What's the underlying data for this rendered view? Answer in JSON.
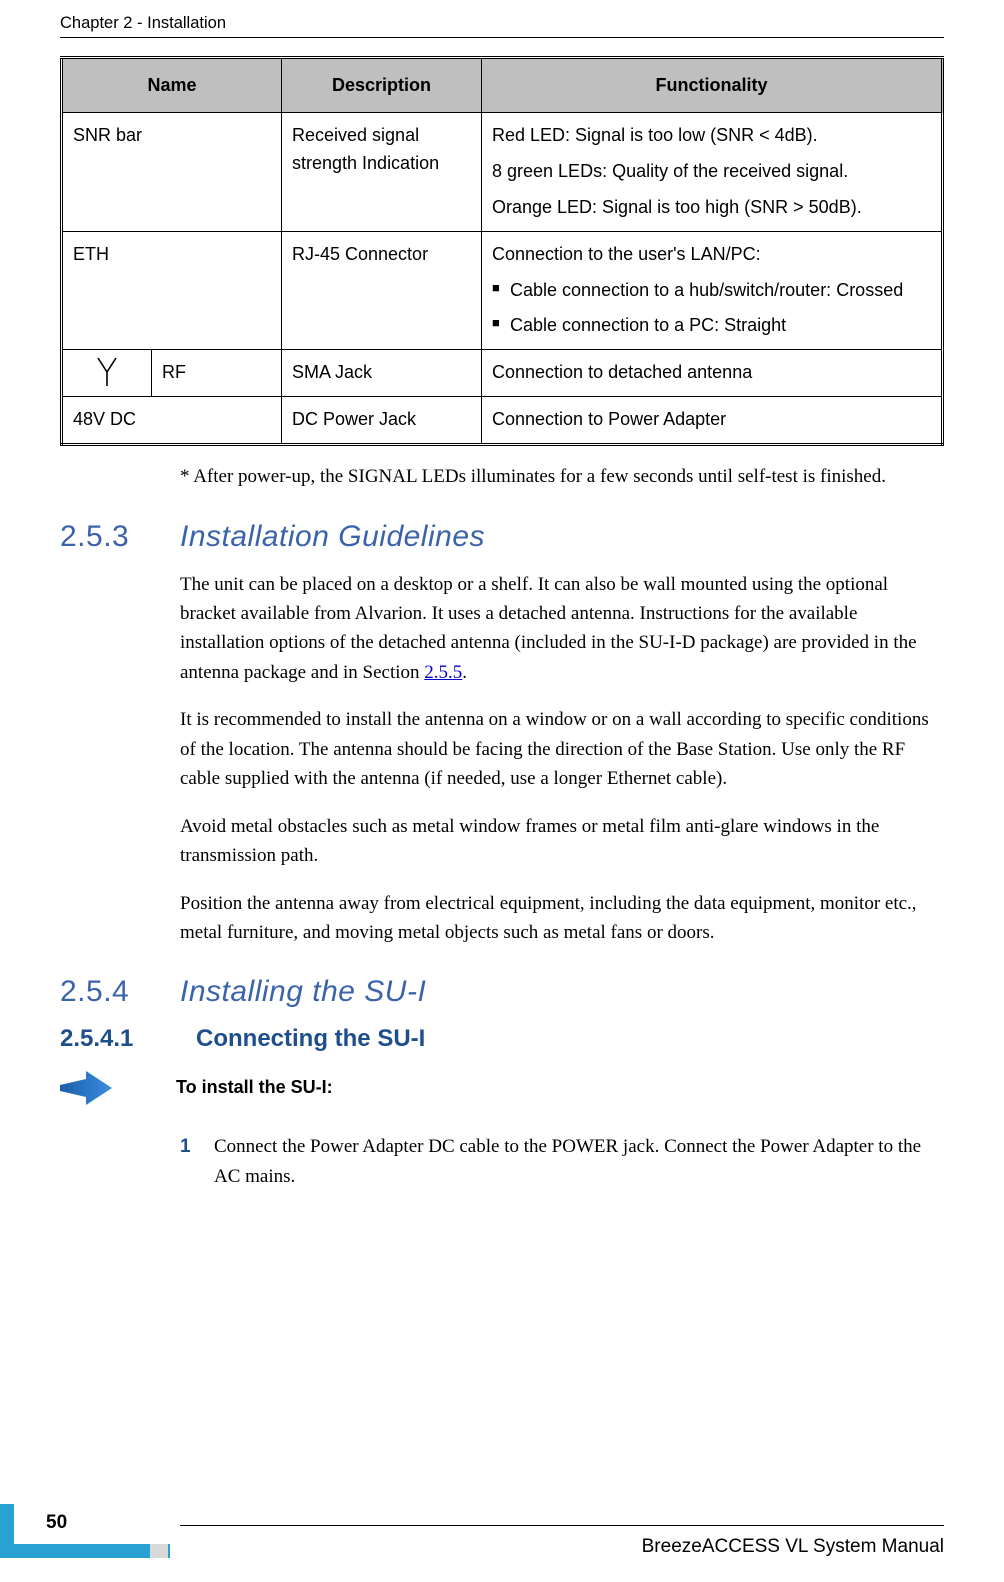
{
  "header": {
    "chapter_line": "Chapter 2 - Installation"
  },
  "table": {
    "headers": {
      "name": "Name",
      "description": "Description",
      "functionality": "Functionality"
    },
    "rows": {
      "snr": {
        "name": "SNR bar",
        "description": "Received signal strength Indication",
        "func_line1": "Red LED: Signal is too low (SNR < 4dB).",
        "func_line2": "8 green LEDs: Quality of the received signal.",
        "func_line3": "Orange LED: Signal is too high (SNR > 50dB)."
      },
      "eth": {
        "name": "ETH",
        "description": "RJ-45 Connector",
        "func_line1": "Connection to the user's LAN/PC:",
        "bullet1": "Cable connection to a hub/switch/router: Crossed",
        "bullet2": "Cable connection to a PC: Straight"
      },
      "rf": {
        "icon": "antenna-icon",
        "name": "RF",
        "description": "SMA Jack",
        "functionality": "Connection to detached antenna"
      },
      "dc": {
        "name": "48V DC",
        "description": "DC Power Jack",
        "functionality": "Connection to Power Adapter"
      }
    }
  },
  "body": {
    "note": "* After power-up, the SIGNAL LEDs illuminates for a few seconds until self-test is finished."
  },
  "sec253": {
    "num": "2.5.3",
    "title": "Installation Guidelines",
    "p1a": "The unit can be placed on a desktop or a shelf. It can also be wall mounted using the optional bracket available from Alvarion. It uses a detached antenna. Instructions for the available installation options of the detached antenna (included in the SU-I-D package) are provided in the antenna package and in Section ",
    "p1_link": "2.5.5",
    "p1b": ".",
    "p2": "It is recommended to install the antenna on a window or on a wall according to specific conditions of the location. The antenna should be facing the direction of the Base Station. Use only the RF cable supplied with the antenna (if needed, use a longer Ethernet cable).",
    "p3": "Avoid metal obstacles such as metal window frames or metal film anti-glare windows in the transmission path.",
    "p4": "Position the antenna away from electrical equipment, including the data equipment, monitor etc., metal furniture, and moving metal objects such as metal fans or doors."
  },
  "sec254": {
    "num": "2.5.4",
    "title": "Installing the SU-I"
  },
  "sec2541": {
    "num": "2.5.4.1",
    "title": "Connecting the SU-I",
    "todo": "To install the SU-I:",
    "step1_num": "1",
    "step1_text": "Connect the Power Adapter DC cable to the POWER jack. Connect the Power Adapter to the AC mains."
  },
  "footer": {
    "manual_title": "BreezeACCESS VL System Manual",
    "page_number": "50"
  }
}
